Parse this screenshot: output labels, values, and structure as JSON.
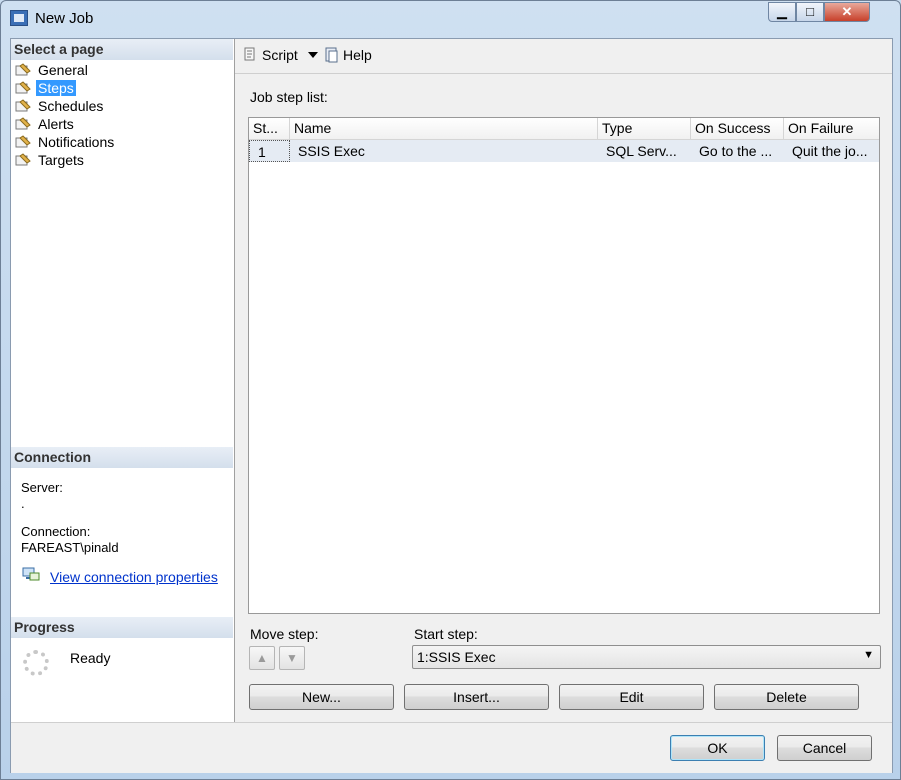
{
  "window": {
    "title": "New Job",
    "minimize": "▁",
    "maximize": "□",
    "close": "✕"
  },
  "left": {
    "select_page_header": "Select a page",
    "pages": [
      {
        "label": "General"
      },
      {
        "label": "Steps"
      },
      {
        "label": "Schedules"
      },
      {
        "label": "Alerts"
      },
      {
        "label": "Notifications"
      },
      {
        "label": "Targets"
      }
    ],
    "connection_header": "Connection",
    "server_label": "Server:",
    "server_value": ".",
    "connection_label": "Connection:",
    "connection_value": "FAREAST\\pinald",
    "view_props_link": "View connection properties",
    "progress_header": "Progress",
    "progress_status": "Ready"
  },
  "toolbar": {
    "script_label": "Script",
    "help_label": "Help"
  },
  "steps": {
    "list_label": "Job step list:",
    "columns": [
      "St...",
      "Name",
      "Type",
      "On Success",
      "On Failure"
    ],
    "rows": [
      [
        "1",
        "SSIS Exec",
        "SQL Serv...",
        "Go to the ...",
        "Quit the jo..."
      ]
    ],
    "move_step_label": "Move step:",
    "start_step_label": "Start step:",
    "start_step_value": "1:SSIS Exec",
    "new_label": "New...",
    "insert_label": "Insert...",
    "edit_label": "Edit",
    "delete_label": "Delete"
  },
  "footer": {
    "ok_label": "OK",
    "cancel_label": "Cancel"
  },
  "colors": {
    "selection": "#3399ff",
    "link": "#0033cc",
    "grid_row": "#e5ebf3"
  }
}
